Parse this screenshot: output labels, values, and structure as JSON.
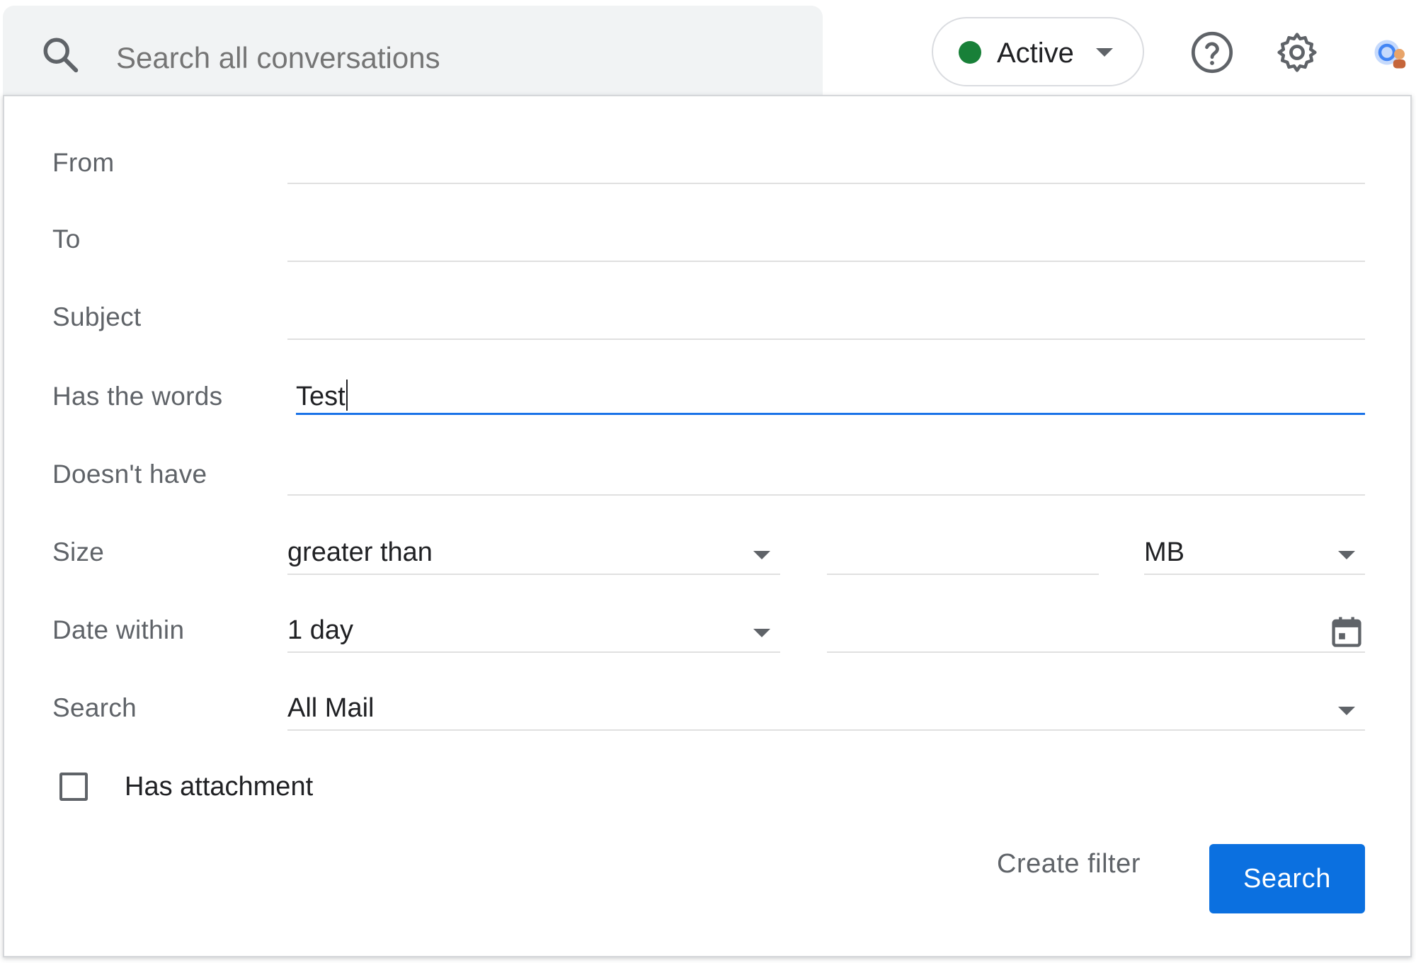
{
  "search": {
    "placeholder": "Search all conversations"
  },
  "status": {
    "label": "Active",
    "dot_color": "#188038"
  },
  "icons": {
    "search": "search-icon",
    "help": "help-icon",
    "settings": "gear-icon",
    "account": "account-icon",
    "calendar": "calendar-icon"
  },
  "form": {
    "from_label": "From",
    "from_value": "",
    "to_label": "To",
    "to_value": "",
    "subject_label": "Subject",
    "subject_value": "",
    "has_words_label": "Has the words",
    "has_words_value": "Test",
    "doesnt_have_label": "Doesn't have",
    "doesnt_have_value": "",
    "size_label": "Size",
    "size_operator": "greater than",
    "size_value": "",
    "size_unit": "MB",
    "date_within_label": "Date within",
    "date_within_value": "1 day",
    "date_value": "",
    "search_label": "Search",
    "search_scope": "All Mail",
    "has_attachment_label": "Has attachment",
    "has_attachment_checked": false
  },
  "actions": {
    "create_filter_label": "Create filter",
    "search_button_label": "Search",
    "accent_color": "#0b70e0"
  }
}
